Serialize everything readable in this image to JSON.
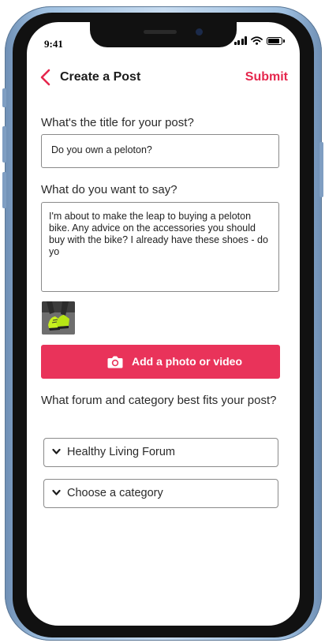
{
  "status_bar": {
    "time": "9:41"
  },
  "nav": {
    "title": "Create a Post",
    "submit_label": "Submit"
  },
  "form": {
    "title_prompt": "What's the title for your post?",
    "title_value": "Do you own a peloton?",
    "body_prompt": "What do you want to say?",
    "body_value": "I'm about to make the leap to buying a peloton bike. Any advice on the accessories you should buy with the bike? I already have these shoes - do yo",
    "attachment_icon": "cycling-shoe-photo",
    "add_media_label": "Add a photo or video",
    "forum_prompt": "What forum and category best fits your post?",
    "forum_selected": "Healthy Living Forum",
    "category_selected": "Choose a category"
  },
  "colors": {
    "accent": "#e5274d",
    "button_bg": "#e9335a",
    "text": "#2a2a2a"
  }
}
